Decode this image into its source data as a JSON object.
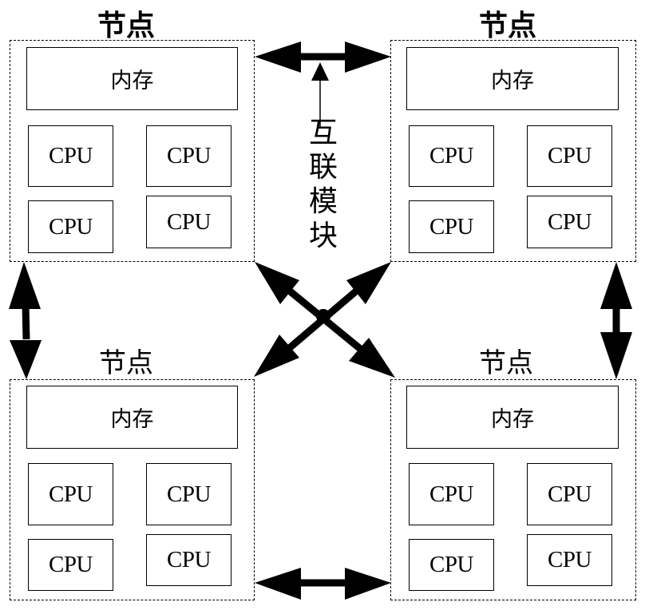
{
  "diagram": {
    "nodes": [
      {
        "id": "top-left",
        "title": "节点",
        "memory_label": "内存",
        "cpus": [
          "CPU",
          "CPU",
          "CPU",
          "CPU"
        ]
      },
      {
        "id": "top-right",
        "title": "节点",
        "memory_label": "内存",
        "cpus": [
          "CPU",
          "CPU",
          "CPU",
          "CPU"
        ]
      },
      {
        "id": "bottom-left",
        "title": "节点",
        "memory_label": "内存",
        "cpus": [
          "CPU",
          "CPU",
          "CPU",
          "CPU"
        ]
      },
      {
        "id": "bottom-right",
        "title": "节点",
        "memory_label": "内存",
        "cpus": [
          "CPU",
          "CPU",
          "CPU",
          "CPU"
        ]
      }
    ],
    "interconnect_label": [
      "互",
      "联",
      "模",
      "块"
    ],
    "connections": [
      {
        "from": "top-left",
        "to": "top-right",
        "type": "bidirectional"
      },
      {
        "from": "bottom-left",
        "to": "bottom-right",
        "type": "bidirectional"
      },
      {
        "from": "top-left",
        "to": "bottom-left",
        "type": "bidirectional"
      },
      {
        "from": "top-right",
        "to": "bottom-right",
        "type": "bidirectional"
      },
      {
        "from": "top-left",
        "to": "bottom-right",
        "type": "bidirectional"
      },
      {
        "from": "top-right",
        "to": "bottom-left",
        "type": "bidirectional"
      }
    ],
    "line_color": "#000000",
    "background_color": "#ffffff"
  }
}
